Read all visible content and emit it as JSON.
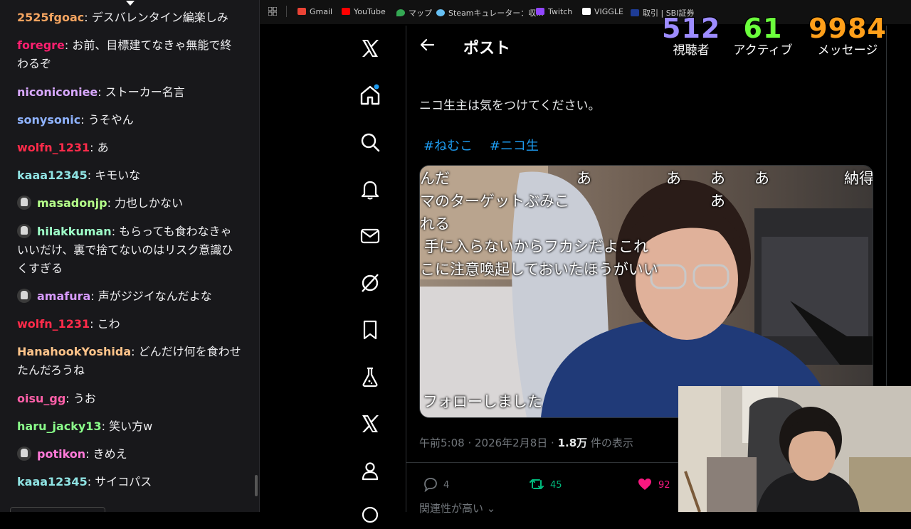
{
  "chat": {
    "messages": [
      {
        "user": "2525fgoac",
        "text": "デスバレンタイン編楽しみ",
        "color": "#f4a460",
        "badge": false
      },
      {
        "user": "foregre",
        "text": "お前、目標建てなきゃ無能で終わるぞ",
        "color": "#ff1f6f",
        "badge": false
      },
      {
        "user": "niconiconiee",
        "text": "ストーカー名言",
        "color": "#d8a8ff",
        "badge": false
      },
      {
        "user": "sonysonic",
        "text": "うそやん",
        "color": "#8fb3ff",
        "badge": false
      },
      {
        "user": "wolfn_1231",
        "text": "あ",
        "color": "#ff2b4a",
        "badge": false
      },
      {
        "user": "kaaa12345",
        "text": "キモいな",
        "color": "#8fe3e3",
        "badge": false
      },
      {
        "user": "masadonjp",
        "text": "力也しかない",
        "color": "#b5ff8a",
        "badge": true
      },
      {
        "user": "hilakkuman",
        "text": "もらっても食わなきゃいいだけ、裏で捨てないのはリスク意識ひくすぎる",
        "color": "#9effc8",
        "badge": true
      },
      {
        "user": "amafura",
        "text": "声がジジイなんだよな",
        "color": "#d79bff",
        "badge": true
      },
      {
        "user": "wolfn_1231",
        "text": "こわ",
        "color": "#ff2b4a",
        "badge": false
      },
      {
        "user": "HanahookYoshida",
        "text": "どんだけ何を食わせたんだろうね",
        "color": "#ffc48a",
        "badge": false
      },
      {
        "user": "oisu_gg",
        "text": "うお",
        "color": "#ff5fa8",
        "badge": false
      },
      {
        "user": "haru_jacky13",
        "text": "笑い方w",
        "color": "#8aff8a",
        "badge": false
      },
      {
        "user": "potikon",
        "text": "きめえ",
        "color": "#ff7ad9",
        "badge": true
      },
      {
        "user": "kaaa12345",
        "text": "サイコパス",
        "color": "#8fe3e3",
        "badge": false
      }
    ]
  },
  "bookmarks": [
    {
      "label": "Gmail",
      "icon": "gmail-icon",
      "color": "#ea4335"
    },
    {
      "label": "YouTube",
      "icon": "youtube-icon",
      "color": "#ff0000"
    },
    {
      "label": "マップ",
      "icon": "maps-icon",
      "color": "#34a853"
    },
    {
      "label": "Steamキュレーター：収...",
      "icon": "steam-icon",
      "color": "#66c0f4"
    },
    {
      "label": "Twitch",
      "icon": "twitch-icon",
      "color": "#9146ff"
    },
    {
      "label": "VIGGLE",
      "icon": "viggle-icon",
      "color": "#ffffff"
    },
    {
      "label": "取引 | SBI証券",
      "icon": "sbi-icon",
      "color": "#1e3c96"
    }
  ],
  "stats": [
    {
      "value": "512",
      "label": "視聴者",
      "color": "#9d8cff"
    },
    {
      "value": "61",
      "label": "アクティブ",
      "color": "#6bff3c"
    },
    {
      "value": "9984",
      "label": "メッセージ",
      "color": "#ff9f1a"
    }
  ],
  "post": {
    "header_title": "ポスト",
    "body": "ニコ生主は気をつけてください。",
    "hashtags": [
      "#ねむこ",
      "#ニコ生"
    ],
    "media_overlay": [
      "んだ",
      "あ",
      "あ",
      "あ",
      "あ",
      "納得",
      "あ",
      "マのターゲットぶみこ",
      "れる",
      "手に入らないからフカシだよこれ",
      "こに注意喚起しておいたほうがいい",
      "フォローしました"
    ],
    "meta": {
      "time": "午前5:08 · 2026年2月8日 · ",
      "views": "1.8万",
      "views_suffix": " 件の表示"
    },
    "actions": {
      "replies": "4",
      "reposts": "45",
      "likes": "92"
    },
    "related": "関連性が高い"
  },
  "colors": {
    "accent": "#1d9bf0",
    "repost": "#00ba7c",
    "like": "#f91880"
  }
}
